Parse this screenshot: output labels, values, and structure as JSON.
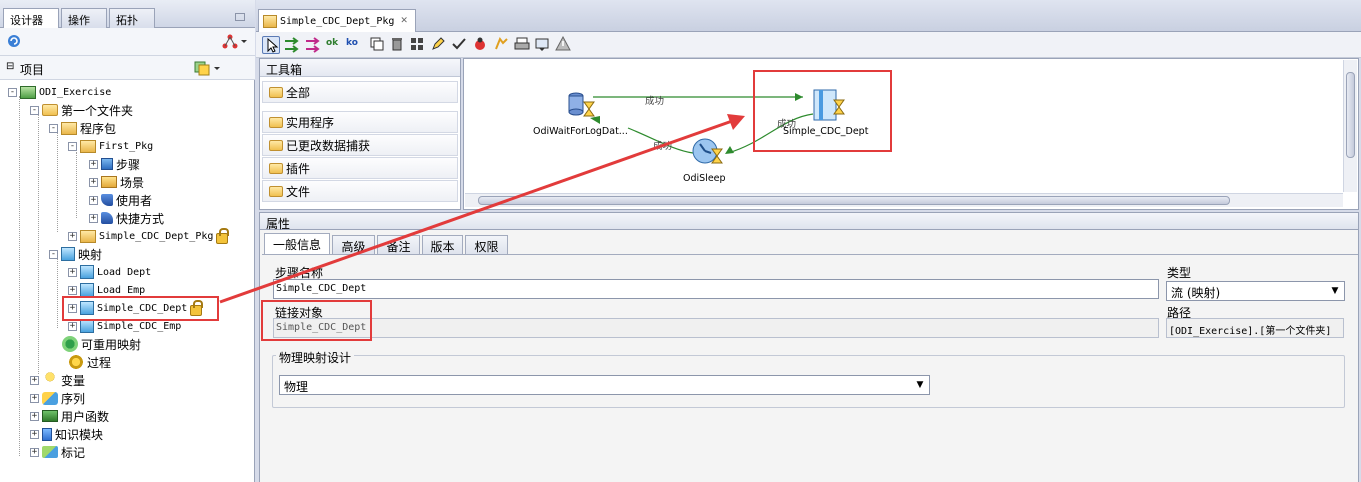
{
  "left_panel": {
    "tabs": [
      "设计器",
      "操作",
      "拓扑"
    ],
    "section_title": "项目",
    "tree": [
      {
        "label": "ODI_Exercise",
        "mono": true
      },
      {
        "label": "第一个文件夹"
      },
      {
        "label": "程序包"
      },
      {
        "label": "First_Pkg",
        "mono": true
      },
      {
        "label": "步骤"
      },
      {
        "label": "场景"
      },
      {
        "label": "使用者"
      },
      {
        "label": "快捷方式"
      },
      {
        "label": "Simple_CDC_Dept_Pkg",
        "mono": true
      },
      {
        "label": "映射"
      },
      {
        "label": "Load Dept",
        "mono": true
      },
      {
        "label": "Load Emp",
        "mono": true
      },
      {
        "label": "Simple_CDC_Dept",
        "mono": true
      },
      {
        "label": "Simple_CDC_Emp",
        "mono": true
      },
      {
        "label": "可重用映射"
      },
      {
        "label": "过程"
      },
      {
        "label": "变量"
      },
      {
        "label": "序列"
      },
      {
        "label": "用户函数"
      },
      {
        "label": "知识模块"
      },
      {
        "label": "标记"
      }
    ]
  },
  "editor": {
    "tab_title": "Simple_CDC_Dept_Pkg",
    "toolbox": {
      "title": "工具箱",
      "items": [
        "全部",
        "实用程序",
        "已更改数据捕获",
        "插件",
        "文件"
      ]
    },
    "diagram": {
      "nodes": {
        "wait": "OdiWaitForLogDat...",
        "sleep": "OdiSleep",
        "mapping": "Simple_CDC_Dept"
      },
      "edge_labels": {
        "ok_top": "成功",
        "ok_right": "成功",
        "ok_left": "成功"
      }
    }
  },
  "properties": {
    "title": "属性",
    "tabs": [
      "一般信息",
      "高级",
      "备注",
      "版本",
      "权限"
    ],
    "step_name_label": "步骤名称",
    "step_name_value": "Simple_CDC_Dept",
    "linked_object_label": "链接对象",
    "linked_object_value": "Simple_CDC_Dept",
    "type_label": "类型",
    "type_value": "流 (映射)",
    "path_label": "路径",
    "path_value": "[ODI_Exercise].[第一个文件夹]",
    "group_label": "物理映射设计",
    "physical_value": "物理"
  },
  "colors": {
    "annotation_red": "#e23b3b",
    "edge_green": "#2e8b2e"
  }
}
